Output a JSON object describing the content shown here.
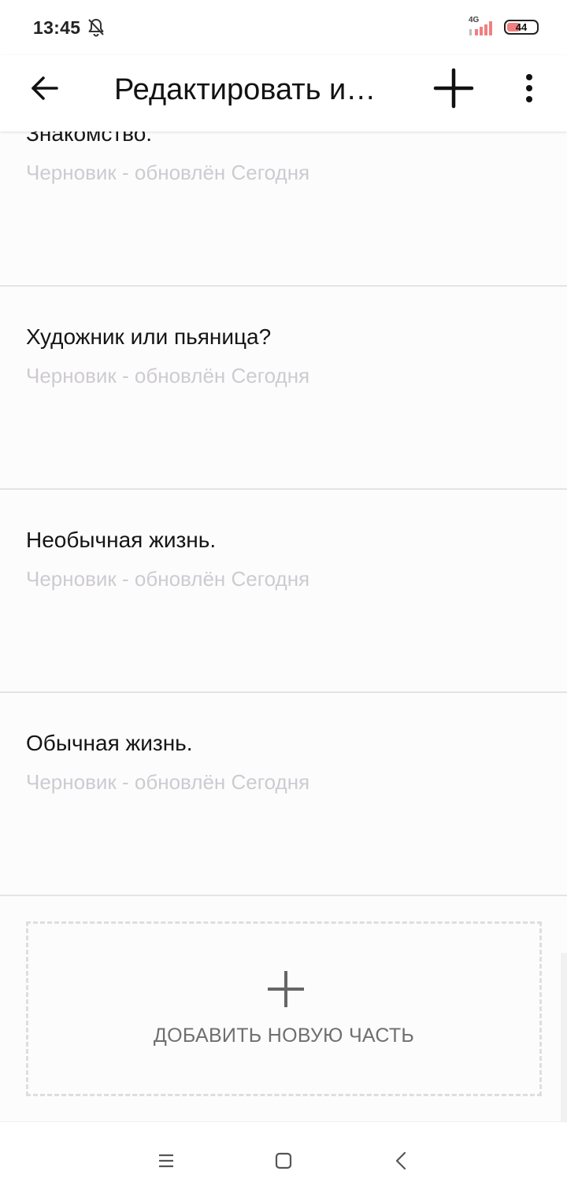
{
  "status_bar": {
    "time": "13:45",
    "network": "4G",
    "battery": "44",
    "battery_level": 0.44
  },
  "app_bar": {
    "title": "Редактировать и…"
  },
  "parts": [
    {
      "title": "Знакомство.",
      "status": "Черновик - обновлён Сегодня"
    },
    {
      "title": "Художник или пьяница?",
      "status": "Черновик - обновлён Сегодня"
    },
    {
      "title": "Необычная жизнь.",
      "status": "Черновик - обновлён Сегодня"
    },
    {
      "title": "Обычная жизнь.",
      "status": "Черновик - обновлён Сегодня"
    }
  ],
  "add_part": {
    "label": "ДОБАВИТЬ НОВУЮ ЧАСТЬ"
  },
  "icons": {
    "bell_off": "bell-off-icon",
    "back": "arrow-left-icon",
    "add": "plus-icon",
    "more": "more-vertical-icon",
    "menu": "menu-icon",
    "home": "square-icon",
    "nav_back": "chevron-left-icon"
  },
  "colors": {
    "status_text": "#cdcbd0",
    "signal_active": "#f08080",
    "divider": "#e4e4e4"
  }
}
